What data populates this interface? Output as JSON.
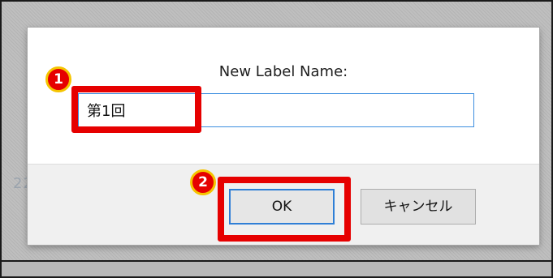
{
  "background": {
    "time_fragment": "22:"
  },
  "dialog": {
    "prompt_label": "New Label Name:",
    "input_value": "第1回",
    "ok_label": "OK",
    "cancel_label": "キャンセル"
  },
  "annotations": {
    "step1": "1",
    "step2": "2"
  },
  "colors": {
    "highlight": "#e60000",
    "badge_border": "#f5c400",
    "input_focus": "#3d8ee0"
  }
}
